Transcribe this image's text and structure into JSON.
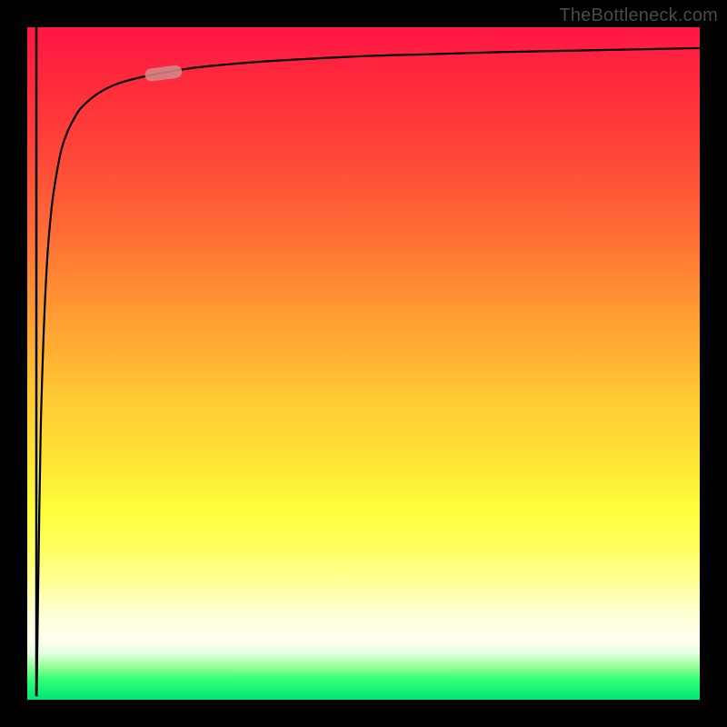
{
  "watermark": "TheBottleneck.com",
  "chart_data": {
    "type": "line",
    "title": "",
    "xlabel": "",
    "ylabel": "",
    "xlim": [
      0,
      100
    ],
    "ylim": [
      0,
      100
    ],
    "grid": false,
    "series": [
      {
        "name": "bottleneck-curve",
        "x": [
          1.4,
          1.6,
          2.0,
          2.5,
          3.0,
          3.5,
          4.0,
          5.0,
          6.0,
          7.0,
          8.0,
          10.0,
          12.0,
          14.0,
          17.0,
          20.0,
          25.0,
          30.0,
          35.0,
          40.0,
          50.0,
          60.0,
          70.0,
          80.0,
          90.0,
          100.0
        ],
        "y": [
          0.5,
          15.0,
          40.0,
          56.0,
          66.0,
          72.0,
          76.0,
          81.5,
          84.5,
          86.5,
          88.0,
          89.8,
          91.0,
          91.8,
          92.6,
          93.2,
          94.0,
          94.5,
          94.9,
          95.2,
          95.7,
          96.0,
          96.3,
          96.5,
          96.7,
          96.9
        ]
      }
    ],
    "annotations": [
      {
        "name": "highlighted-segment",
        "shape": "pill",
        "x_range": [
          17.5,
          23.0
        ],
        "y_range": [
          92.8,
          93.5
        ],
        "color": "#d48b8b"
      }
    ],
    "colors": {
      "gradient_top": "#ff1744",
      "gradient_mid": "#ffff3d",
      "gradient_bottom": "#00e676",
      "curve": "#000000",
      "frame": "#000000",
      "highlight": "#d48b8b"
    }
  }
}
